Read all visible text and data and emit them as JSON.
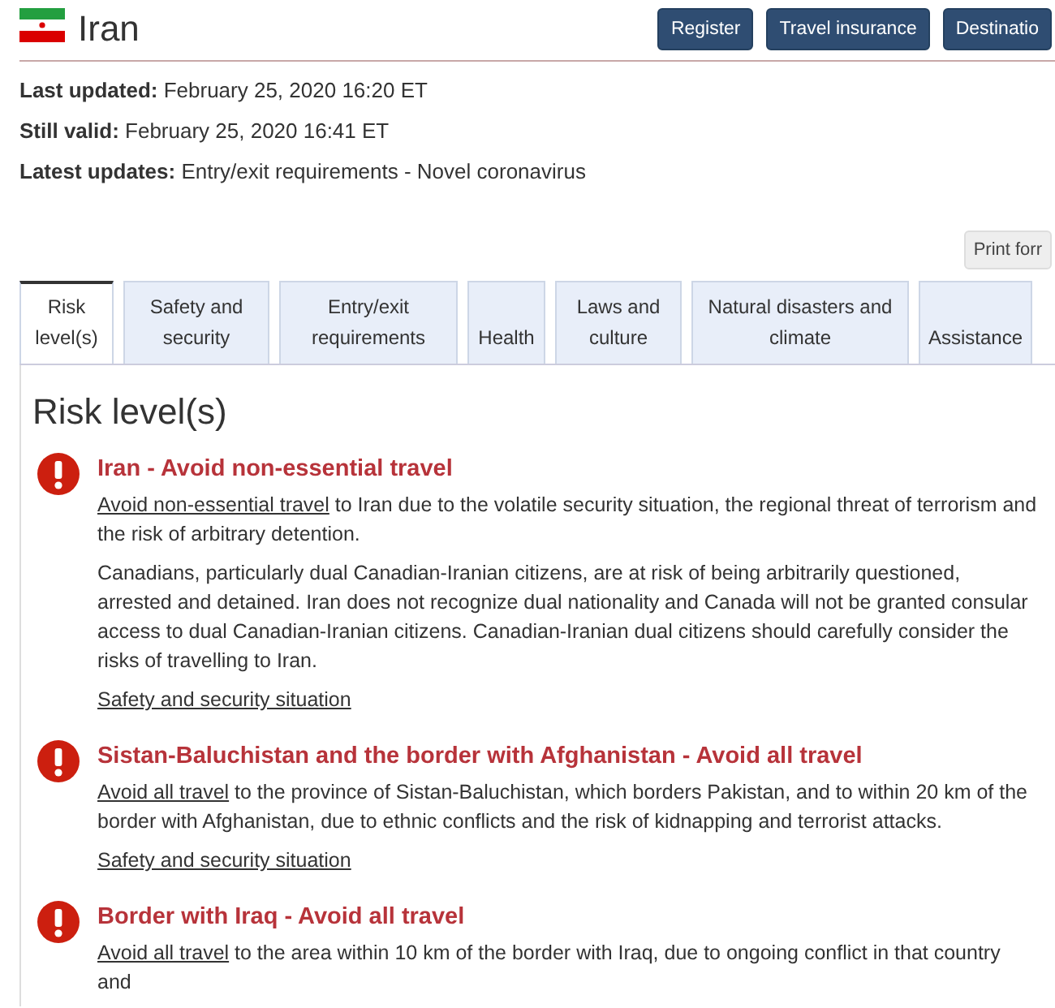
{
  "header": {
    "title": "Iran",
    "buttons": [
      "Register",
      "Travel insurance",
      "Destinatio"
    ]
  },
  "meta": [
    {
      "label": "Last updated:",
      "value": "February 25, 2020 16:20 ET"
    },
    {
      "label": "Still valid:",
      "value": "February 25, 2020 16:41 ET"
    },
    {
      "label": "Latest updates:",
      "value": "Entry/exit requirements - Novel coronavirus"
    }
  ],
  "print_button": "Print forr",
  "tabs": [
    {
      "label": "Risk level(s)",
      "selected": true
    },
    {
      "label": "Safety and security",
      "selected": false
    },
    {
      "label": "Entry/exit requirements",
      "selected": false
    },
    {
      "label": "Health",
      "selected": false
    },
    {
      "label": "Laws and culture",
      "selected": false
    },
    {
      "label": "Natural disasters and climate",
      "selected": false
    },
    {
      "label": "Assistance",
      "selected": false
    }
  ],
  "panel": {
    "heading": "Risk level(s)",
    "advisories": [
      {
        "title": "Iran - Avoid non-essential travel",
        "link": "Avoid non-essential travel",
        "text": " to Iran due to the volatile security situation, the regional threat of terrorism and the risk of arbitrary detention.",
        "paragraphs": [
          "Canadians, particularly dual Canadian-Iranian citizens, are at risk of being arbitrarily questioned, arrested and detained. Iran does not recognize dual nationality and Canada will not be granted consular access to dual Canadian-Iranian citizens. Canadian-Iranian dual citizens should carefully consider the risks of travelling to Iran."
        ],
        "more_link": "Safety and security situation"
      },
      {
        "title": "Sistan-Baluchistan and the border with Afghanistan - Avoid all travel",
        "link": "Avoid all travel",
        "text": " to the province of Sistan-Baluchistan, which borders Pakistan, and to within 20 km of the border with Afghanistan, due to ethnic conflicts and the risk of kidnapping and terrorist attacks.",
        "more_link": "Safety and security situation"
      },
      {
        "title": "Border with Iraq - Avoid all travel",
        "link": "Avoid all travel",
        "text": " to the area within 10 km of the border with Iraq, due to ongoing conflict in that country and"
      }
    ]
  }
}
